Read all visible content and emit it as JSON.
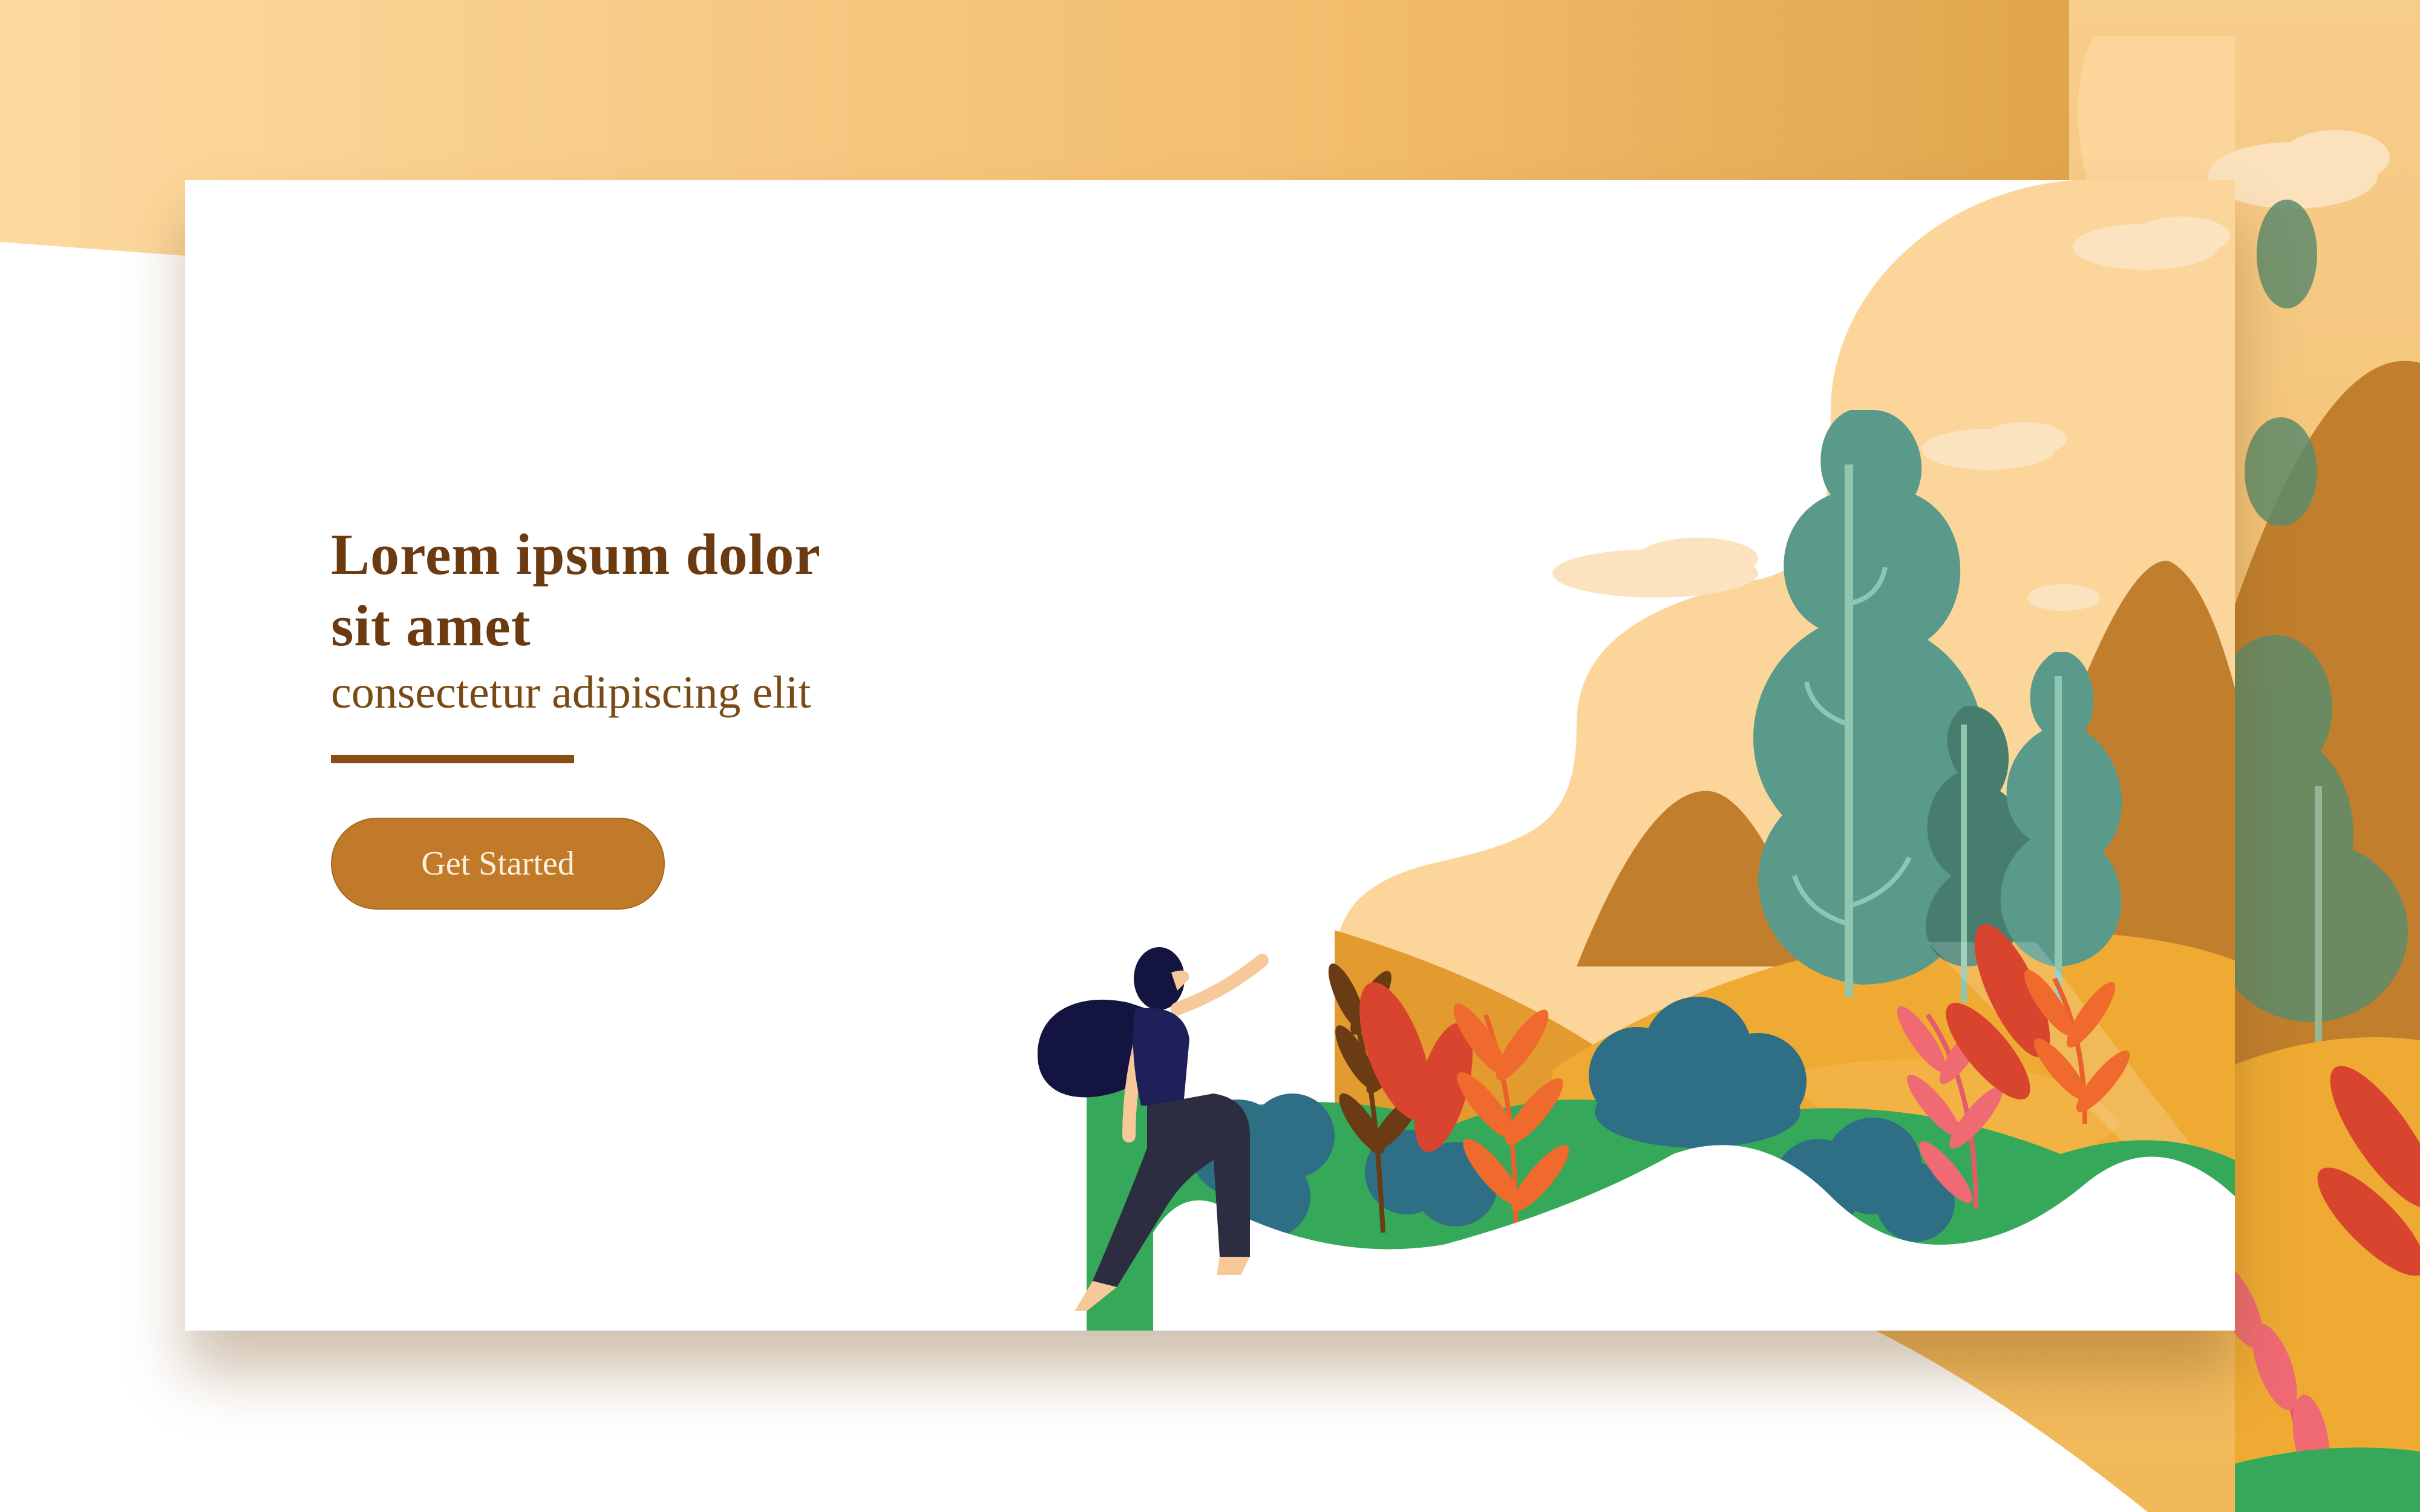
{
  "hero": {
    "title_line1": "Lorem ipsum dolor",
    "title_line2": "sit amet",
    "subtitle": "consectetur adipiscing elit",
    "cta_label": "Get Started"
  },
  "colors": {
    "heading": "#6b3a10",
    "subtitle": "#7a4a16",
    "underline": "#8a4e14",
    "button_bg": "#c07a2a",
    "button_text": "#fdf1dc",
    "sky": "#fcd59a",
    "hill_orange": "#eeaa33",
    "mountain": "#c17f2d",
    "tree_teal": "#5a9a8a",
    "bush_blue": "#2e6f86",
    "grass_green": "#35a85a",
    "leaf_red": "#d9442e",
    "leaf_pink": "#f06a74",
    "figure_navy": "#141440"
  },
  "illustration": {
    "scene": "autumn-landscape",
    "elements": [
      "mountain-icon",
      "tree-icon",
      "cloud-icon",
      "bush-icon",
      "fern-icon",
      "running-woman-figure"
    ]
  }
}
